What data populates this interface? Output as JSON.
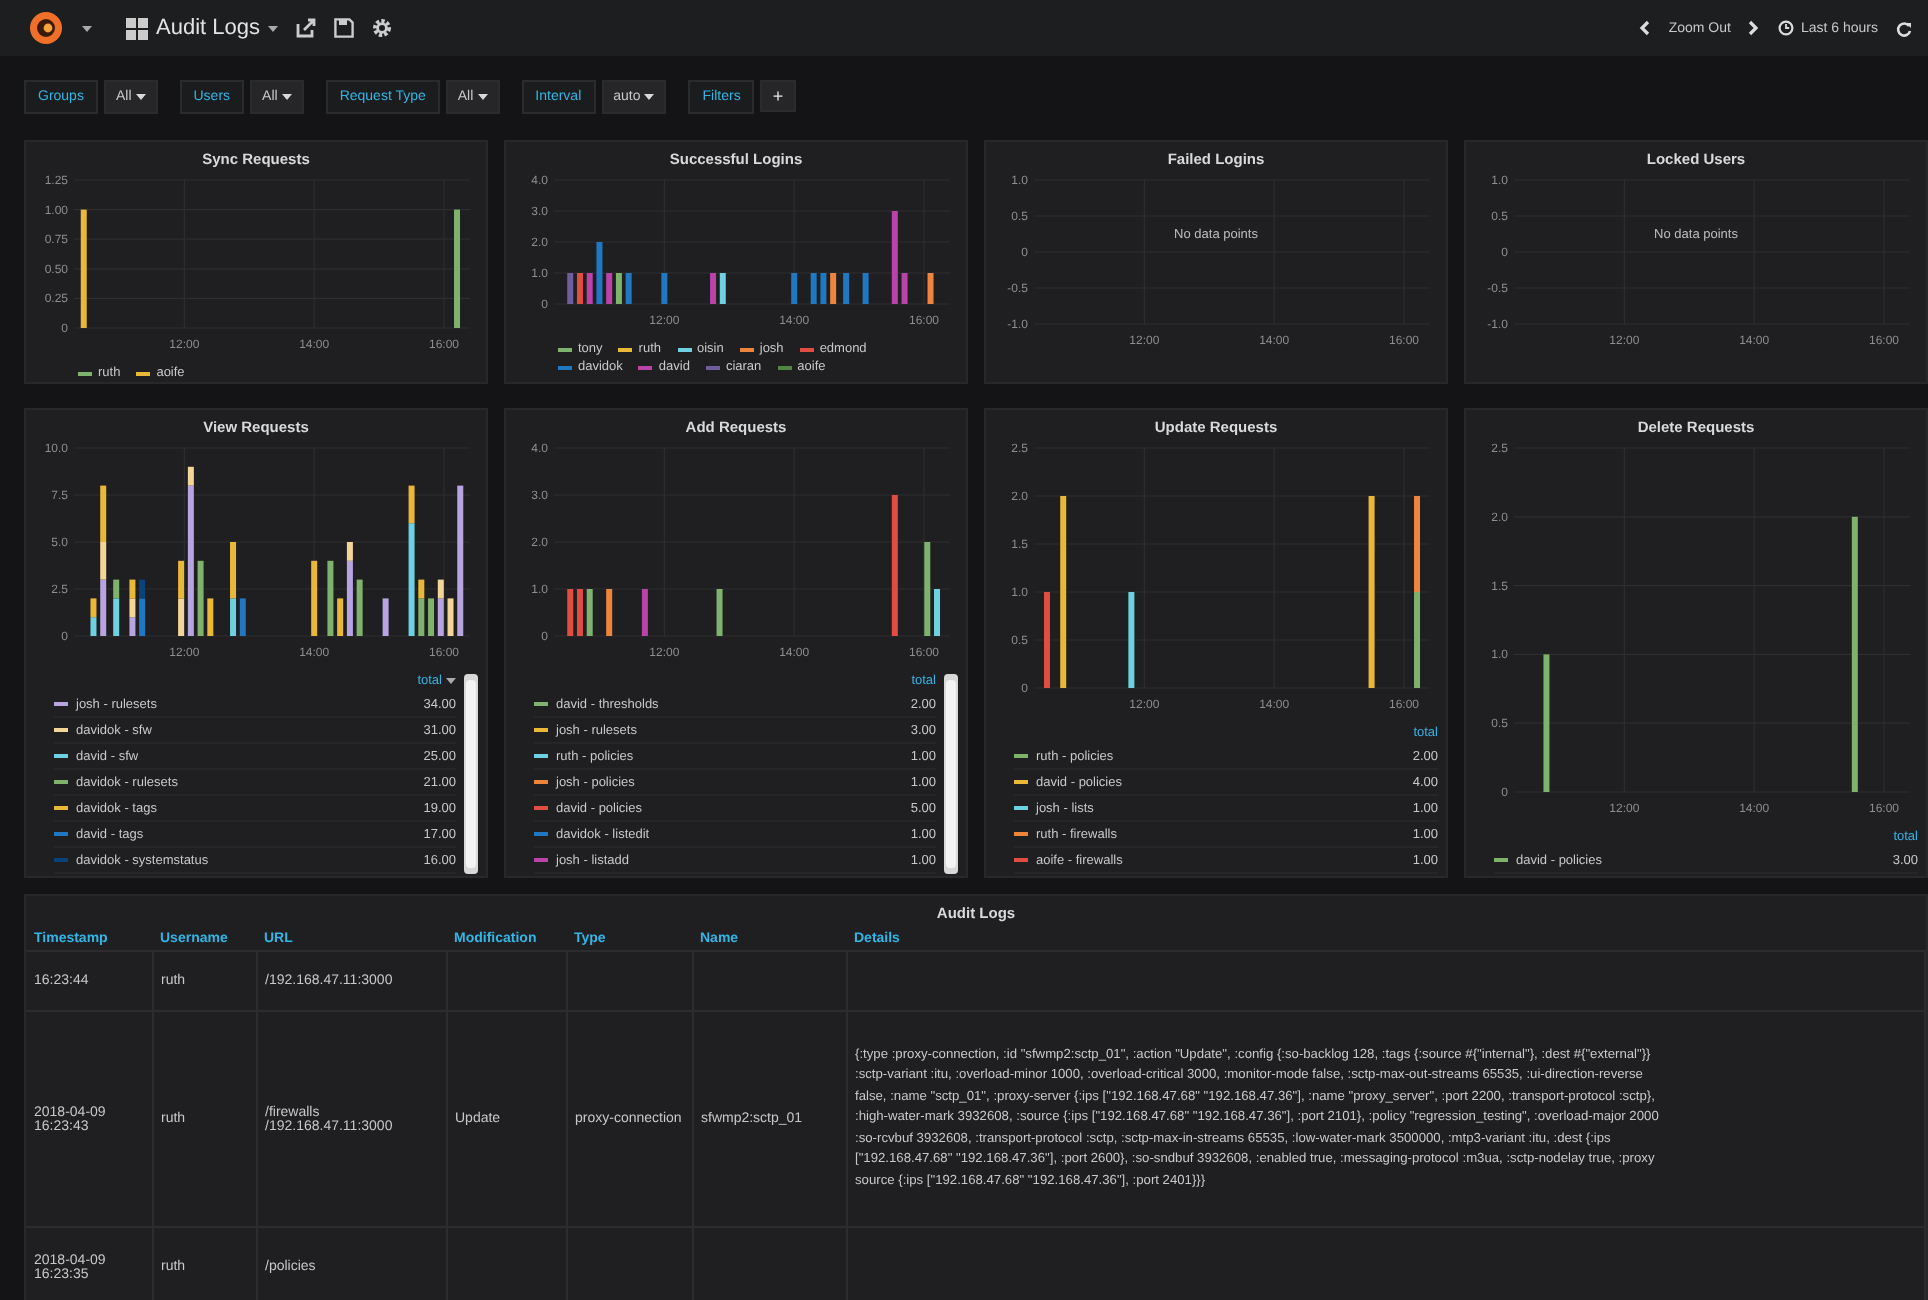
{
  "navbar": {
    "dashboard_title": "Audit Logs",
    "zoom_label": "Zoom Out",
    "time_range": "Last 6 hours"
  },
  "variables": [
    {
      "label": "Groups",
      "value": "All"
    },
    {
      "label": "Users",
      "value": "All"
    },
    {
      "label": "Request Type",
      "value": "All"
    },
    {
      "label": "Interval",
      "value": "auto"
    }
  ],
  "filters": {
    "label": "Filters",
    "add": "+"
  },
  "panels": [
    {
      "title": "Sync Requests",
      "kind": "inline",
      "chart_data": {
        "type": "bar",
        "grid": true,
        "stacked": true,
        "xlim": [
          10.3,
          16.4
        ],
        "ylim": [
          0,
          1.25
        ],
        "xticks": [
          {
            "value": 12,
            "label": "12:00"
          },
          {
            "value": 14,
            "label": "14:00"
          },
          {
            "value": 16,
            "label": "16:00"
          }
        ],
        "yticks": [
          {
            "value": 0,
            "label": "0"
          },
          {
            "value": 0.25,
            "label": "0.25"
          },
          {
            "value": 0.5,
            "label": "0.50"
          },
          {
            "value": 0.75,
            "label": "0.75"
          },
          {
            "value": 1,
            "label": "1.00"
          },
          {
            "value": 1.25,
            "label": "1.25"
          }
        ],
        "x": [
          10.45,
          16.2
        ],
        "series": [
          {
            "name": "ruth",
            "color": "#7eb26d",
            "values": [
              null,
              1
            ]
          },
          {
            "name": "aoife",
            "color": "#eab839",
            "values": [
              1,
              null
            ]
          }
        ]
      }
    },
    {
      "title": "Successful Logins",
      "kind": "inline",
      "chart_data": {
        "type": "bar",
        "grid": true,
        "stacked": true,
        "xlim": [
          10.3,
          16.4
        ],
        "ylim": [
          0,
          4
        ],
        "xticks": [
          {
            "value": 12,
            "label": "12:00"
          },
          {
            "value": 14,
            "label": "14:00"
          },
          {
            "value": 16,
            "label": "16:00"
          }
        ],
        "yticks": [
          {
            "value": 0,
            "label": "0"
          },
          {
            "value": 1,
            "label": "1.0"
          },
          {
            "value": 2,
            "label": "2.0"
          },
          {
            "value": 3,
            "label": "3.0"
          },
          {
            "value": 4,
            "label": "4.0"
          }
        ],
        "x": [
          10.55,
          10.7,
          10.85,
          11.0,
          11.15,
          11.3,
          11.45,
          12.0,
          12.75,
          12.9,
          14.0,
          14.3,
          14.45,
          14.6,
          14.8,
          15.1,
          15.55,
          15.7,
          16.1
        ],
        "series": [
          {
            "name": "tony",
            "color": "#7eb26d",
            "values": [
              null,
              null,
              null,
              null,
              null,
              1,
              null,
              null,
              null,
              null,
              null,
              null,
              null,
              null,
              null,
              null,
              null,
              null,
              null
            ]
          },
          {
            "name": "ruth",
            "color": "#eab839",
            "values": [
              null,
              null,
              null,
              null,
              null,
              null,
              null,
              null,
              null,
              null,
              null,
              null,
              null,
              null,
              null,
              null,
              null,
              null,
              null
            ]
          },
          {
            "name": "oisin",
            "color": "#6ed0e0",
            "values": [
              null,
              null,
              null,
              null,
              null,
              null,
              null,
              null,
              null,
              1,
              null,
              null,
              null,
              null,
              null,
              null,
              null,
              null,
              null
            ]
          },
          {
            "name": "josh",
            "color": "#ef843c",
            "values": [
              null,
              null,
              null,
              null,
              null,
              null,
              null,
              null,
              null,
              null,
              null,
              null,
              null,
              1,
              null,
              null,
              null,
              null,
              1
            ]
          },
          {
            "name": "edmond",
            "color": "#e24d42",
            "values": [
              null,
              1,
              null,
              null,
              null,
              null,
              null,
              null,
              null,
              null,
              null,
              null,
              null,
              null,
              null,
              null,
              null,
              null,
              null
            ]
          },
          {
            "name": "davidok",
            "color": "#1f78c1",
            "values": [
              null,
              null,
              null,
              2,
              null,
              null,
              1,
              1,
              null,
              null,
              1,
              1,
              1,
              null,
              1,
              1,
              null,
              null,
              null
            ]
          },
          {
            "name": "david",
            "color": "#ba43a9",
            "values": [
              null,
              null,
              1,
              null,
              1,
              null,
              null,
              null,
              1,
              null,
              null,
              null,
              null,
              null,
              null,
              null,
              3,
              1,
              null
            ]
          },
          {
            "name": "ciaran",
            "color": "#705da0",
            "values": [
              1,
              null,
              null,
              null,
              null,
              null,
              null,
              null,
              null,
              null,
              null,
              null,
              null,
              null,
              null,
              null,
              null,
              null,
              null
            ]
          },
          {
            "name": "aoife",
            "color": "#508642",
            "values": [
              null,
              null,
              null,
              null,
              null,
              null,
              null,
              null,
              null,
              null,
              null,
              null,
              null,
              null,
              null,
              null,
              null,
              null,
              null
            ]
          }
        ]
      }
    },
    {
      "title": "Failed Logins",
      "kind": "none",
      "message": "No data points",
      "chart_data": {
        "type": "bar",
        "grid": true,
        "xlim": [
          10.3,
          16.4
        ],
        "ylim": [
          -1,
          1
        ],
        "xticks": [
          {
            "value": 12,
            "label": "12:00"
          },
          {
            "value": 14,
            "label": "14:00"
          },
          {
            "value": 16,
            "label": "16:00"
          }
        ],
        "yticks": [
          {
            "value": -1,
            "label": "-1.0"
          },
          {
            "value": -0.5,
            "label": "-0.5"
          },
          {
            "value": 0,
            "label": "0"
          },
          {
            "value": 0.5,
            "label": "0.5"
          },
          {
            "value": 1,
            "label": "1.0"
          }
        ]
      }
    },
    {
      "title": "Locked Users",
      "kind": "none",
      "message": "No data points",
      "chart_data": {
        "type": "bar",
        "grid": true,
        "xlim": [
          10.3,
          16.4
        ],
        "ylim": [
          -1,
          1
        ],
        "xticks": [
          {
            "value": 12,
            "label": "12:00"
          },
          {
            "value": 14,
            "label": "14:00"
          },
          {
            "value": 16,
            "label": "16:00"
          }
        ],
        "yticks": [
          {
            "value": -1,
            "label": "-1.0"
          },
          {
            "value": -0.5,
            "label": "-0.5"
          },
          {
            "value": 0,
            "label": "0"
          },
          {
            "value": 0.5,
            "label": "0.5"
          },
          {
            "value": 1,
            "label": "1.0"
          }
        ]
      }
    },
    {
      "title": "View Requests",
      "kind": "table",
      "legend_header": "total",
      "sort_desc": true,
      "legend_scrollable": true,
      "totals": [
        "34.00",
        "31.00",
        "25.00",
        "21.00",
        "19.00",
        "17.00",
        "16.00"
      ],
      "chart_data": {
        "type": "bar",
        "grid": true,
        "stacked": true,
        "xlim": [
          10.3,
          16.4
        ],
        "ylim": [
          0,
          10
        ],
        "xticks": [
          {
            "value": 12,
            "label": "12:00"
          },
          {
            "value": 14,
            "label": "14:00"
          },
          {
            "value": 16,
            "label": "16:00"
          }
        ],
        "yticks": [
          {
            "value": 0,
            "label": "0"
          },
          {
            "value": 2.5,
            "label": "2.5"
          },
          {
            "value": 5,
            "label": "5.0"
          },
          {
            "value": 7.5,
            "label": "7.5"
          },
          {
            "value": 10,
            "label": "10.0"
          }
        ],
        "x": [
          10.6,
          10.75,
          10.95,
          11.2,
          11.35,
          11.95,
          12.1,
          12.25,
          12.4,
          12.75,
          12.9,
          14.0,
          14.25,
          14.4,
          14.55,
          14.7,
          15.1,
          15.5,
          15.65,
          15.8,
          15.95,
          16.1,
          16.25
        ],
        "series": [
          {
            "name": "josh - rulesets",
            "color": "#b7a4e0",
            "values": [
              null,
              3,
              null,
              1,
              null,
              null,
              8,
              null,
              null,
              null,
              null,
              null,
              null,
              null,
              4,
              null,
              2,
              null,
              null,
              null,
              2,
              null,
              8
            ]
          },
          {
            "name": "davidok - sfw",
            "color": "#f4d598",
            "values": [
              null,
              2,
              null,
              1,
              null,
              2,
              1,
              null,
              null,
              null,
              null,
              null,
              null,
              null,
              1,
              null,
              null,
              null,
              null,
              null,
              1,
              2,
              null
            ]
          },
          {
            "name": "david - sfw",
            "color": "#6ed0e0",
            "values": [
              1,
              null,
              2,
              null,
              null,
              null,
              null,
              null,
              null,
              2,
              null,
              null,
              null,
              null,
              null,
              null,
              null,
              6,
              null,
              null,
              null,
              null,
              null
            ]
          },
          {
            "name": "davidok - rulesets",
            "color": "#7eb26d",
            "values": [
              null,
              null,
              1,
              null,
              null,
              null,
              null,
              4,
              null,
              null,
              null,
              null,
              4,
              null,
              null,
              3,
              null,
              null,
              2,
              2,
              null,
              null,
              null
            ]
          },
          {
            "name": "davidok - tags",
            "color": "#eab839",
            "values": [
              1,
              3,
              null,
              1,
              null,
              2,
              null,
              null,
              2,
              3,
              null,
              4,
              null,
              2,
              null,
              null,
              null,
              2,
              1,
              null,
              null,
              null,
              null
            ]
          },
          {
            "name": "david - tags",
            "color": "#1f78c1",
            "values": [
              null,
              null,
              null,
              null,
              2,
              null,
              null,
              null,
              null,
              null,
              2,
              null,
              null,
              null,
              null,
              null,
              null,
              null,
              null,
              null,
              null,
              null,
              null
            ]
          },
          {
            "name": "davidok - systemstatus",
            "color": "#0a437c",
            "values": [
              null,
              null,
              null,
              null,
              1,
              null,
              null,
              null,
              null,
              null,
              null,
              null,
              null,
              null,
              null,
              null,
              null,
              null,
              null,
              null,
              null,
              null,
              null
            ]
          }
        ]
      }
    },
    {
      "title": "Add Requests",
      "kind": "table",
      "legend_header": "total",
      "sort_desc": false,
      "legend_scrollable": true,
      "totals": [
        "2.00",
        "3.00",
        "1.00",
        "1.00",
        "5.00",
        "1.00",
        "1.00"
      ],
      "chart_data": {
        "type": "bar",
        "grid": true,
        "stacked": true,
        "xlim": [
          10.3,
          16.4
        ],
        "ylim": [
          0,
          4
        ],
        "xticks": [
          {
            "value": 12,
            "label": "12:00"
          },
          {
            "value": 14,
            "label": "14:00"
          },
          {
            "value": 16,
            "label": "16:00"
          }
        ],
        "yticks": [
          {
            "value": 0,
            "label": "0"
          },
          {
            "value": 1,
            "label": "1.0"
          },
          {
            "value": 2,
            "label": "2.0"
          },
          {
            "value": 3,
            "label": "3.0"
          },
          {
            "value": 4,
            "label": "4.0"
          }
        ],
        "x": [
          10.55,
          10.7,
          10.85,
          11.15,
          11.7,
          12.85,
          15.55,
          16.05,
          16.2
        ],
        "series": [
          {
            "name": "david - thresholds",
            "color": "#7eb26d",
            "values": [
              null,
              null,
              1,
              null,
              null,
              1,
              null,
              2,
              null
            ]
          },
          {
            "name": "josh - rulesets",
            "color": "#eab839",
            "values": [
              null,
              null,
              null,
              null,
              null,
              null,
              null,
              null,
              null
            ]
          },
          {
            "name": "ruth - policies",
            "color": "#6ed0e0",
            "values": [
              null,
              null,
              null,
              null,
              null,
              null,
              null,
              null,
              1
            ]
          },
          {
            "name": "josh - policies",
            "color": "#ef843c",
            "values": [
              null,
              null,
              null,
              1,
              null,
              null,
              null,
              null,
              null
            ]
          },
          {
            "name": "david - policies",
            "color": "#e24d42",
            "values": [
              1,
              1,
              null,
              null,
              null,
              null,
              3,
              null,
              null
            ]
          },
          {
            "name": "davidok - listedit",
            "color": "#1f78c1",
            "values": [
              null,
              null,
              null,
              null,
              null,
              null,
              null,
              null,
              null
            ]
          },
          {
            "name": "josh - listadd",
            "color": "#ba43a9",
            "values": [
              null,
              null,
              null,
              null,
              1,
              null,
              null,
              null,
              null
            ]
          }
        ]
      }
    },
    {
      "title": "Update Requests",
      "kind": "table",
      "legend_header": "total",
      "sort_desc": false,
      "legend_scrollable": false,
      "totals": [
        "2.00",
        "4.00",
        "1.00",
        "1.00",
        "1.00"
      ],
      "chart_data": {
        "type": "bar",
        "grid": true,
        "stacked": true,
        "xlim": [
          10.3,
          16.4
        ],
        "ylim": [
          0,
          2.5
        ],
        "xticks": [
          {
            "value": 12,
            "label": "12:00"
          },
          {
            "value": 14,
            "label": "14:00"
          },
          {
            "value": 16,
            "label": "16:00"
          }
        ],
        "yticks": [
          {
            "value": 0,
            "label": "0"
          },
          {
            "value": 0.5,
            "label": "0.5"
          },
          {
            "value": 1,
            "label": "1.0"
          },
          {
            "value": 1.5,
            "label": "1.5"
          },
          {
            "value": 2,
            "label": "2.0"
          },
          {
            "value": 2.5,
            "label": "2.5"
          }
        ],
        "x": [
          10.5,
          10.75,
          11.8,
          15.5,
          16.2
        ],
        "series": [
          {
            "name": "ruth - policies",
            "color": "#7eb26d",
            "values": [
              null,
              null,
              null,
              null,
              1
            ]
          },
          {
            "name": "david - policies",
            "color": "#eab839",
            "values": [
              null,
              2,
              null,
              2,
              null
            ]
          },
          {
            "name": "josh - lists",
            "color": "#6ed0e0",
            "values": [
              null,
              null,
              1,
              null,
              null
            ]
          },
          {
            "name": "ruth - firewalls",
            "color": "#ef843c",
            "values": [
              null,
              null,
              null,
              null,
              1
            ]
          },
          {
            "name": "aoife - firewalls",
            "color": "#e24d42",
            "values": [
              1,
              null,
              null,
              null,
              null
            ]
          }
        ]
      }
    },
    {
      "title": "Delete Requests",
      "kind": "table",
      "legend_header": "total",
      "sort_desc": false,
      "legend_scrollable": false,
      "totals": [
        "3.00"
      ],
      "chart_data": {
        "type": "bar",
        "grid": true,
        "stacked": true,
        "xlim": [
          10.3,
          16.4
        ],
        "ylim": [
          0,
          2.5
        ],
        "xticks": [
          {
            "value": 12,
            "label": "12:00"
          },
          {
            "value": 14,
            "label": "14:00"
          },
          {
            "value": 16,
            "label": "16:00"
          }
        ],
        "yticks": [
          {
            "value": 0,
            "label": "0"
          },
          {
            "value": 0.5,
            "label": "0.5"
          },
          {
            "value": 1,
            "label": "1.0"
          },
          {
            "value": 1.5,
            "label": "1.5"
          },
          {
            "value": 2,
            "label": "2.0"
          },
          {
            "value": 2.5,
            "label": "2.5"
          }
        ],
        "x": [
          10.8,
          15.55
        ],
        "series": [
          {
            "name": "david - policies",
            "color": "#7eb26d",
            "values": [
              1,
              2
            ]
          }
        ]
      }
    }
  ],
  "audit_logs": {
    "title": "Audit Logs",
    "columns": [
      "Timestamp",
      "Username",
      "URL",
      "Modification",
      "Type",
      "Name",
      "Details"
    ],
    "rows": [
      {
        "timestamp": "16:23:44",
        "username": "ruth",
        "url": "/192.168.47.11:3000"
      },
      {
        "timestamp": "2018-04-09 16:23:43",
        "username": "ruth",
        "url": "/firewalls /192.168.47.11:3000",
        "modification": "Update",
        "type": "proxy-connection",
        "name": "sfwmp2:sctp_01",
        "details": [
          "{:type :proxy-connection, :id \"sfwmp2:sctp_01\", :action \"Update\", :config {:so-backlog 128, :tags {:source #{\"internal\"}, :dest #{\"external\"}}",
          ":sctp-variant :itu, :overload-minor 1000, :overload-critical 3000, :monitor-mode false, :sctp-max-out-streams 65535, :ui-direction-reverse",
          "false, :name \"sctp_01\", :proxy-server {:ips [\"192.168.47.68\" \"192.168.47.36\"], :name \"proxy_server\", :port 2200, :transport-protocol :sctp},",
          ":high-water-mark 3932608, :source {:ips [\"192.168.47.68\" \"192.168.47.36\"], :port 2101}, :policy \"regression_testing\", :overload-major 2000",
          ":so-rcvbuf 3932608, :transport-protocol :sctp, :sctp-max-in-streams 65535, :low-water-mark 3500000, :mtp3-variant :itu, :dest {:ips",
          "[\"192.168.47.68\" \"192.168.47.36\"], :port 2600}, :so-sndbuf 3932608, :enabled true, :messaging-protocol :m3ua, :sctp-nodelay true, :proxy",
          "source {:ips [\"192.168.47.68\" \"192.168.47.36\"], :port 2401}}}"
        ]
      },
      {
        "timestamp": "2018-04-09 16:23:35",
        "username": "ruth",
        "url": "/policies"
      }
    ]
  }
}
